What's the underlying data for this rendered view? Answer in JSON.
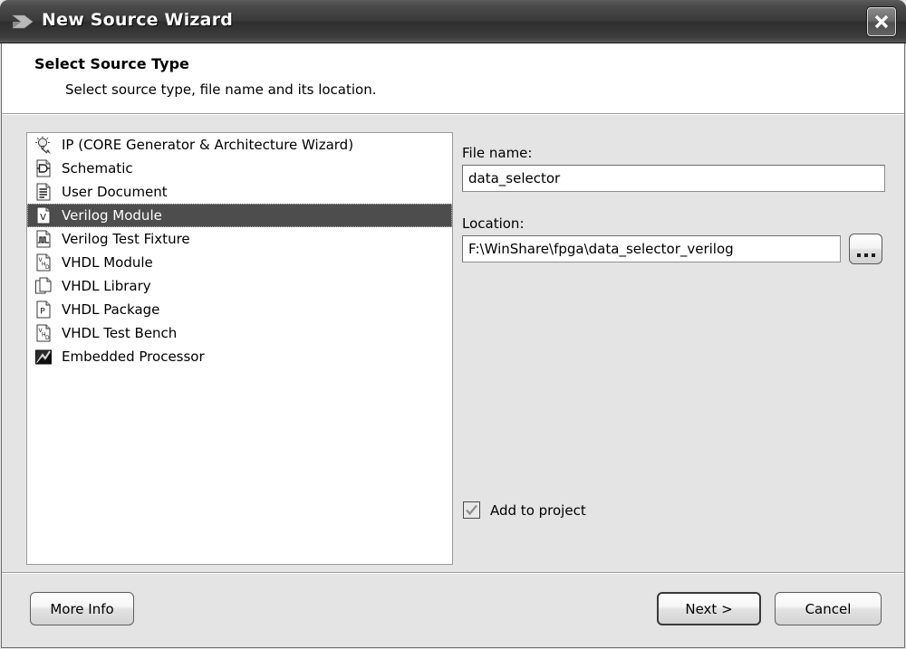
{
  "window": {
    "title": "New Source Wizard",
    "title_icon": "wizard-arrow-icon",
    "close_label": "Close"
  },
  "header": {
    "title": "Select Source Type",
    "subtitle": "Select source type, file name and its location."
  },
  "source_list": {
    "selected_index": 3,
    "items": [
      {
        "label": "IP (CORE Generator & Architecture Wizard)",
        "icon": "ip-core-generator-icon"
      },
      {
        "label": "Schematic",
        "icon": "schematic-icon"
      },
      {
        "label": "User Document",
        "icon": "user-document-icon"
      },
      {
        "label": "Verilog Module",
        "icon": "verilog-module-icon"
      },
      {
        "label": "Verilog Test Fixture",
        "icon": "verilog-test-fixture-icon"
      },
      {
        "label": "VHDL Module",
        "icon": "vhdl-module-icon"
      },
      {
        "label": "VHDL Library",
        "icon": "vhdl-library-icon"
      },
      {
        "label": "VHDL Package",
        "icon": "vhdl-package-icon"
      },
      {
        "label": "VHDL Test Bench",
        "icon": "vhdl-test-bench-icon"
      },
      {
        "label": "Embedded Processor",
        "icon": "embedded-processor-icon"
      }
    ]
  },
  "form": {
    "filename_label": "File name:",
    "filename_value": "data_selector",
    "location_label": "Location:",
    "location_value": "F:\\WinShare\\fpga\\data_selector_verilog",
    "browse_label": "...",
    "add_to_project_label": "Add to project",
    "add_to_project_checked": true
  },
  "buttons": {
    "more_info": "More Info",
    "next": "Next >",
    "cancel": "Cancel"
  },
  "colors": {
    "titlebar_dark": "#2e2e2e",
    "selection": "#4d4d4d",
    "dialog_bg": "#e4e4e4",
    "field_bg": "#ffffff"
  }
}
